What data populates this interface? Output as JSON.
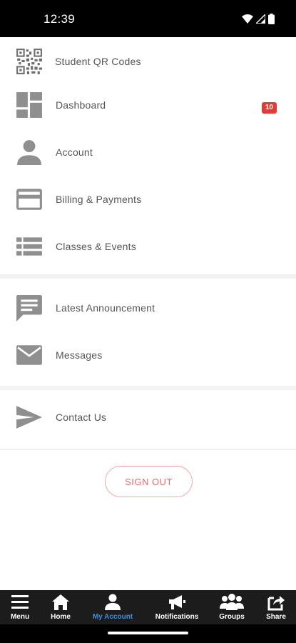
{
  "status": {
    "time": "12:39"
  },
  "menu": {
    "items": [
      {
        "label": "Student QR Codes"
      },
      {
        "label": "Dashboard"
      },
      {
        "label": "Account",
        "badge": "10"
      },
      {
        "label": "Billing & Payments"
      },
      {
        "label": "Classes & Events"
      },
      {
        "label": "Latest Announcement"
      },
      {
        "label": "Messages"
      },
      {
        "label": "Contact Us"
      }
    ]
  },
  "signout_label": "SIGN OUT",
  "tabs": [
    {
      "label": "Menu",
      "icon": "hamburger-icon"
    },
    {
      "label": "Home",
      "icon": "home-icon"
    },
    {
      "label": "My Account",
      "icon": "person-icon",
      "active": true
    },
    {
      "label": "Notifications",
      "icon": "megaphone-icon"
    },
    {
      "label": "Groups",
      "icon": "groups-icon"
    },
    {
      "label": "Share",
      "icon": "share-icon"
    }
  ],
  "colors": {
    "accent": "#3d8fe0",
    "badge": "#e53935",
    "signout": "#ea6a6a",
    "icon": "#8f8f8f"
  }
}
